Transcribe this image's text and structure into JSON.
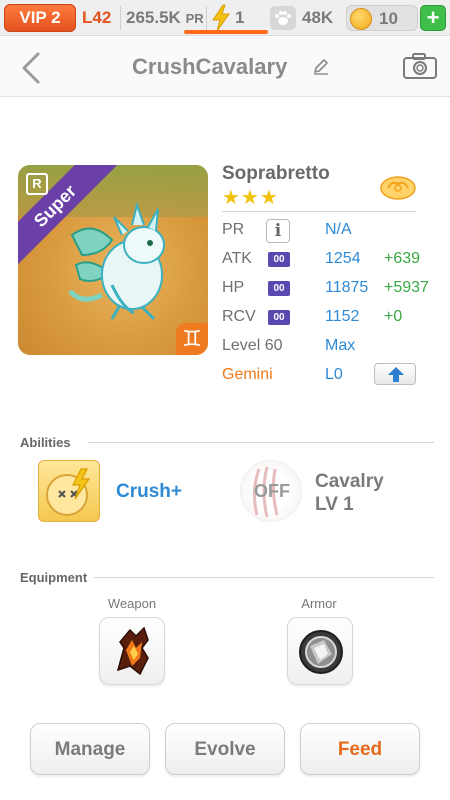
{
  "status_bar": {
    "vip": "VIP 2",
    "level": "L42",
    "power_rating": "265.5K",
    "power_rating_unit": "PR",
    "energy": "1",
    "food": "48K",
    "coins": "10",
    "add_label": "+",
    "energy_icon": "lightning-bolt-icon",
    "food_icon": "paw-icon",
    "coin_icon": "coin-icon"
  },
  "header": {
    "title": "CrushCavalary",
    "back_icon": "chevron-left-icon",
    "edit_icon": "pencil-icon",
    "camera_icon": "camera-icon"
  },
  "monster": {
    "rarity_badge": "R",
    "rarity": "Super",
    "name": "Soprabretto",
    "stars": "★★★",
    "element_icon": "cloud-icon",
    "zodiac_icon": "gemini-icon",
    "zodiac_glyph": "♊"
  },
  "stats": {
    "pr": {
      "label": "PR",
      "info": "i",
      "value": "N/A"
    },
    "atk": {
      "label": "ATK",
      "rank": "00",
      "value": "1254",
      "bonus": "+639"
    },
    "hp": {
      "label": "HP",
      "rank": "00",
      "value": "11875",
      "bonus": "+5937"
    },
    "rcv": {
      "label": "RCV",
      "rank": "00",
      "value": "1152",
      "bonus": "+0"
    },
    "level": {
      "label": "Level 60",
      "value": "Max"
    },
    "gemini": {
      "label": "Gemini",
      "value": "L0"
    }
  },
  "abilities": {
    "title": "Abilities",
    "primary": {
      "name": "Crush+"
    },
    "secondary": {
      "state": "OFF",
      "name": "Cavalry",
      "level": "LV 1"
    }
  },
  "equipment": {
    "title": "Equipment",
    "weapon_label": "Weapon",
    "armor_label": "Armor"
  },
  "buttons": {
    "manage": "Manage",
    "evolve": "Evolve",
    "feed": "Feed"
  },
  "colors": {
    "accent_orange": "#e66a1c",
    "value_blue": "#2f8ad6",
    "bonus_green": "#3aa843",
    "rank_purple": "#5948b0"
  }
}
